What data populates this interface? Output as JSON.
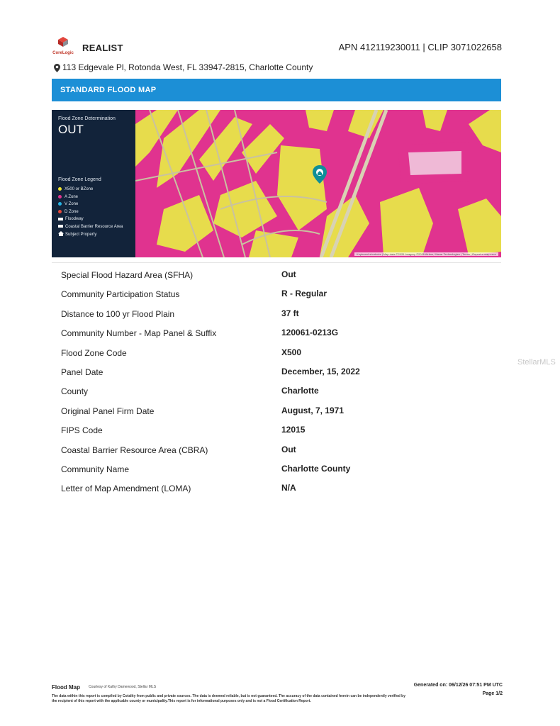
{
  "header": {
    "logo_text": "CoreLogic",
    "brand": "REALIST",
    "apn": "APN 412119230011 | CLIP 3071022658"
  },
  "address": "113 Edgevale Pl, Rotonda West, FL 33947-2815, Charlotte County",
  "section_title": "STANDARD FLOOD MAP",
  "map_panel": {
    "determination_label": "Flood Zone Determination",
    "determination_value": "OUT",
    "legend_title": "Flood Zone Legend",
    "legend": [
      {
        "label": "X500 or BZone",
        "color": "#f2e630",
        "shape": "dot"
      },
      {
        "label": "A Zone",
        "color": "#e0338f",
        "shape": "dot"
      },
      {
        "label": "V Zone",
        "color": "#26b5e6",
        "shape": "dot"
      },
      {
        "label": "D Zone",
        "color": "#e8483a",
        "shape": "dot"
      },
      {
        "label": "Floodway",
        "color": "#ffffff",
        "shape": "rect"
      },
      {
        "label": "Coastal Barrier Resource Area",
        "color": "#ffffff",
        "shape": "rect"
      },
      {
        "label": "Subject Property",
        "color": "#ffffff",
        "shape": "home-icon"
      }
    ],
    "attribution": "Keyboard shortcuts | Map data ©2026 Imagery ©2026 Airbus, Maxar Technologies | Terms | Report a map error"
  },
  "map_colors": {
    "a_zone": "#e0338f",
    "x500_zone": "#e7dc4c",
    "road": "#c9c2a0",
    "pin": "#0e8f98"
  },
  "details": [
    {
      "label": "Special Flood Hazard Area (SFHA)",
      "value": "Out"
    },
    {
      "label": "Community Participation Status",
      "value": "R - Regular"
    },
    {
      "label": "Distance to 100 yr Flood Plain",
      "value": "37 ft"
    },
    {
      "label": "Community Number - Map Panel & Suffix",
      "value": "120061-0213G"
    },
    {
      "label": "Flood Zone Code",
      "value": "X500"
    },
    {
      "label": "Panel Date",
      "value": "December, 15, 2022"
    },
    {
      "label": "County",
      "value": "Charlotte"
    },
    {
      "label": "Original Panel Firm Date",
      "value": "August, 7, 1971"
    },
    {
      "label": "FIPS Code",
      "value": "12015"
    },
    {
      "label": "Coastal Barrier Resource Area (CBRA)",
      "value": "Out"
    },
    {
      "label": "Community Name",
      "value": "Charlotte County"
    },
    {
      "label": "Letter of Map Amendment (LOMA)",
      "value": "N/A"
    }
  ],
  "watermark": "StellarMLS",
  "footer": {
    "title": "Flood Map",
    "courtesy": "Courtesy of Kathy Damewood, Stellar MLS",
    "disclaimer": "The data within this report is compiled by Cotality from public and private sources. The data is deemed reliable, but is not guaranteed. The accuracy of the data contained herein can be independently verified by the recipient of this report with the applicable county or municipality.This report is for informational purposes only and is not a Flood Certification Report.",
    "generated": "Generated on: 06/12/26 07:51 PM UTC",
    "page": "Page 1/2"
  }
}
